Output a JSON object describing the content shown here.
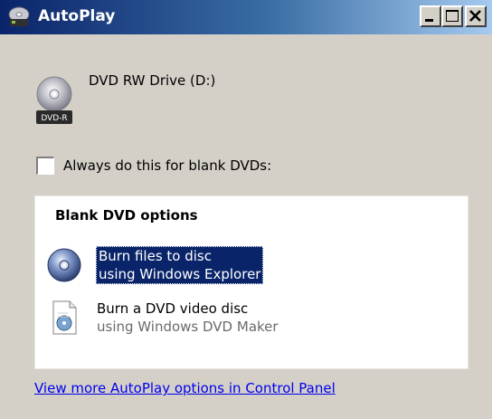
{
  "window": {
    "title": "AutoPlay",
    "title_icon": "autoplay-icon",
    "controls": {
      "minimize_icon": "minimize-icon",
      "maximize_icon": "maximize-icon",
      "close_icon": "close-icon"
    }
  },
  "drive": {
    "label": "DVD RW Drive (D:)",
    "icon": "dvd-drive-icon",
    "badge": "DVD-R"
  },
  "always_checkbox": {
    "label": "Always do this for blank DVDs:",
    "checked": false
  },
  "options_panel": {
    "title": "Blank DVD options",
    "items": [
      {
        "icon": "disc-burn-icon",
        "line1": "Burn files to disc",
        "line2": "using Windows Explorer",
        "selected": true
      },
      {
        "icon": "dvd-maker-icon",
        "line1": "Burn a DVD video disc",
        "line2": "using Windows DVD Maker",
        "selected": false
      }
    ]
  },
  "control_panel_link": "View more AutoPlay options in Control Panel",
  "colors": {
    "titlebar_start": "#0a246a",
    "titlebar_end": "#a6caf0",
    "selection": "#0a246a",
    "link": "#0000ee",
    "window_bg": "#d4d0c8"
  }
}
